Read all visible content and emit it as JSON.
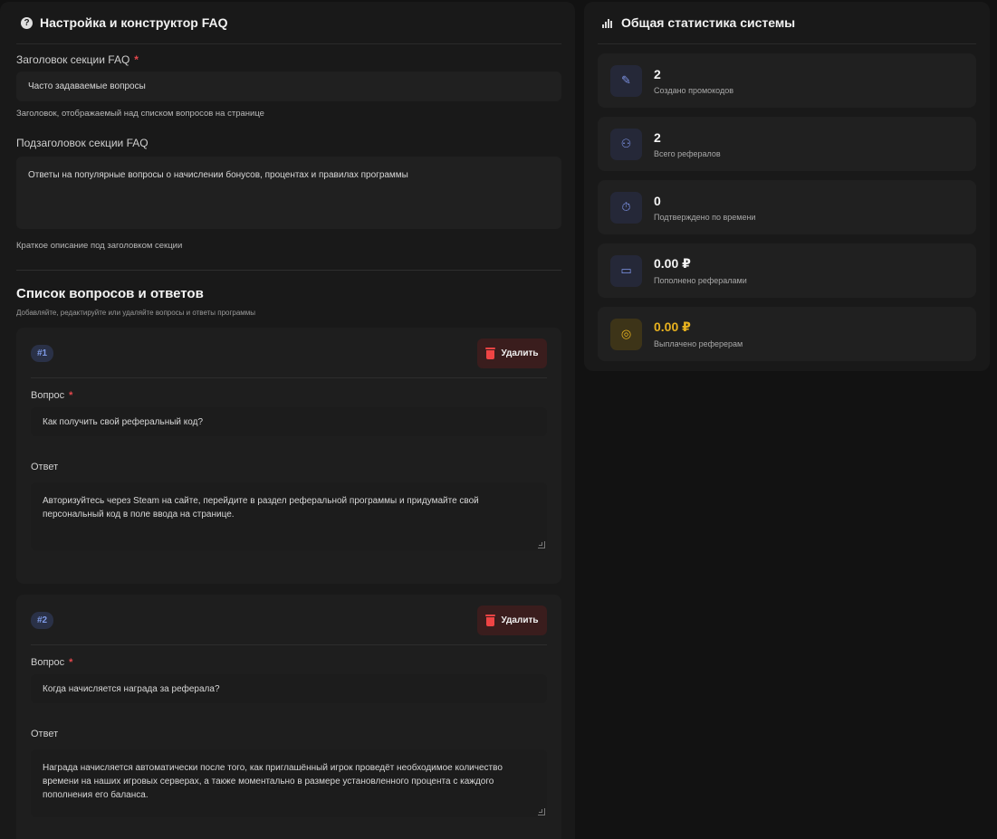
{
  "faq_settings": {
    "title": "Настройка и конструктор FAQ",
    "heading_label": "Заголовок секции FAQ",
    "required_mark": "*",
    "heading_value": "Часто задаваемые вопросы",
    "heading_hint": "Заголовок, отображаемый над списком вопросов на странице",
    "subheading_label": "Подзаголовок секции FAQ",
    "subheading_value": "Ответы на популярные вопросы о начислении бонусов, процентах и правилах программы",
    "subheading_hint": "Краткое описание под заголовком секции"
  },
  "qa_list": {
    "title": "Список вопросов и ответов",
    "subtitle": "Добавляйте, редактируйте или удаляйте вопросы и ответы программы",
    "delete_label": "Удалить",
    "question_label": "Вопрос",
    "answer_label": "Ответ",
    "items": [
      {
        "number": "#1",
        "question": "Как получить свой реферальный код?",
        "answer": "Авторизуйтесь через Steam на сайте, перейдите в раздел реферальной программы и придумайте свой персональный код в поле ввода на странице."
      },
      {
        "number": "#2",
        "question": "Когда начисляется награда за реферала?",
        "answer": "Награда начисляется автоматически после того, как приглашённый игрок проведёт необходимое количество времени на наших игровых серверах, а также моментально в размере установленного процента с каждого пополнения его баланса."
      }
    ]
  },
  "stats": {
    "title": "Общая статистика системы",
    "accent_color": "#7f95e8",
    "gold_color": "#e8b21f",
    "cards": [
      {
        "value": "2",
        "label": "Создано промокодов",
        "icon": "ticket-icon"
      },
      {
        "value": "2",
        "label": "Всего рефералов",
        "icon": "users-icon"
      },
      {
        "value": "0",
        "label": "Подтверждено по времени",
        "icon": "stopwatch-icon"
      },
      {
        "value": "0.00 ₽",
        "label": "Пополнено рефералами",
        "icon": "credit-card-icon"
      },
      {
        "value": "0.00 ₽",
        "label": "Выплачено реферерам",
        "icon": "coins-icon"
      }
    ]
  }
}
